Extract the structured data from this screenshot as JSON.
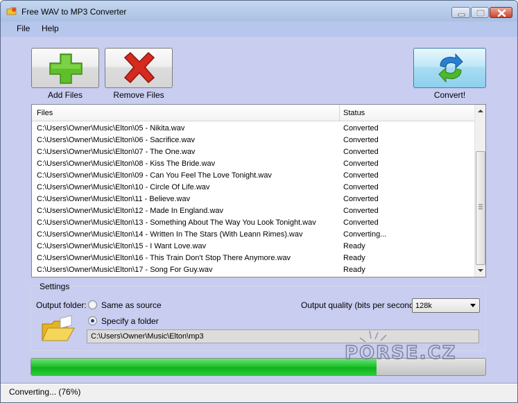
{
  "window": {
    "title": "Free WAV to MP3 Converter",
    "icon": "app-folder-icon"
  },
  "menu": {
    "items": [
      "File",
      "Help"
    ]
  },
  "toolbar": {
    "add_label": "Add Files",
    "remove_label": "Remove Files",
    "convert_label": "Convert!",
    "add_icon": "plus-icon",
    "remove_icon": "cross-icon",
    "convert_icon": "refresh-arrows-icon"
  },
  "files_list": {
    "columns": [
      "Files",
      "Status"
    ],
    "rows": [
      {
        "file": "C:\\Users\\Owner\\Music\\Elton\\05 - Nikita.wav",
        "status": "Converted"
      },
      {
        "file": "C:\\Users\\Owner\\Music\\Elton\\06 - Sacrifice.wav",
        "status": "Converted"
      },
      {
        "file": "C:\\Users\\Owner\\Music\\Elton\\07 - The One.wav",
        "status": "Converted"
      },
      {
        "file": "C:\\Users\\Owner\\Music\\Elton\\08 - Kiss The Bride.wav",
        "status": "Converted"
      },
      {
        "file": "C:\\Users\\Owner\\Music\\Elton\\09 - Can You Feel The Love Tonight.wav",
        "status": "Converted"
      },
      {
        "file": "C:\\Users\\Owner\\Music\\Elton\\10 - Circle Of Life.wav",
        "status": "Converted"
      },
      {
        "file": "C:\\Users\\Owner\\Music\\Elton\\11 - Believe.wav",
        "status": "Converted"
      },
      {
        "file": "C:\\Users\\Owner\\Music\\Elton\\12 - Made In England.wav",
        "status": "Converted"
      },
      {
        "file": "C:\\Users\\Owner\\Music\\Elton\\13 - Something About The Way You Look Tonight.wav",
        "status": "Converted"
      },
      {
        "file": "C:\\Users\\Owner\\Music\\Elton\\14 - Written In The Stars (With Leann Rimes).wav",
        "status": "Converting..."
      },
      {
        "file": "C:\\Users\\Owner\\Music\\Elton\\15 - I Want Love.wav",
        "status": "Ready"
      },
      {
        "file": "C:\\Users\\Owner\\Music\\Elton\\16 - This Train Don't Stop There Anymore.wav",
        "status": "Ready"
      },
      {
        "file": "C:\\Users\\Owner\\Music\\Elton\\17 - Song For Guy.wav",
        "status": "Ready"
      }
    ]
  },
  "settings": {
    "title": "Settings",
    "output_folder_label": "Output folder:",
    "same_as_source_label": "Same as source",
    "specify_folder_label": "Specify a folder",
    "selected_option": "specify",
    "folder_path": "C:\\Users\\Owner\\Music\\Elton\\mp3",
    "quality_label": "Output quality (bits per second):",
    "quality_value": "128k",
    "folder_icon": "folder-icon"
  },
  "progress": {
    "percent": 76
  },
  "status_bar": {
    "text": "Converting... (76%)"
  },
  "watermark": {
    "text": "PORSE.CZ"
  },
  "colors": {
    "window_bg": "#c9cdf0",
    "progress_green": "#22c42f",
    "remove_red": "#d62a1e",
    "add_green": "#5fbf2a",
    "convert_blue": "#2a7ed1"
  }
}
